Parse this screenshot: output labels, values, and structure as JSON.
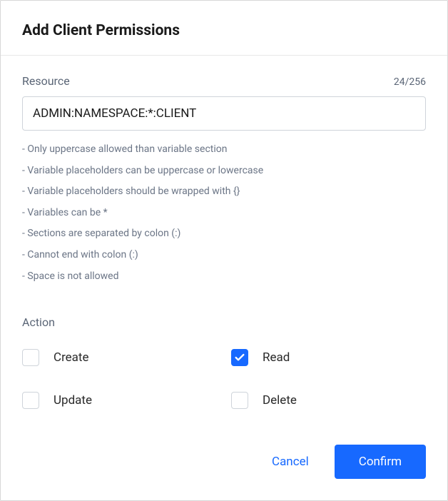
{
  "modal": {
    "title": "Add Client Permissions"
  },
  "resource": {
    "label": "Resource",
    "value": "ADMIN:NAMESPACE:*:CLIENT",
    "char_count": "24/256",
    "hints": [
      "Only uppercase allowed than variable section",
      "Variable placeholders can be uppercase or lowercase",
      "Variable placeholders should be wrapped with {}",
      "Variables can be *",
      "Sections are separated by colon (:)",
      "Cannot end with colon (:)",
      "Space is not allowed"
    ]
  },
  "action": {
    "label": "Action",
    "options": [
      {
        "label": "Create",
        "checked": false
      },
      {
        "label": "Read",
        "checked": true
      },
      {
        "label": "Update",
        "checked": false
      },
      {
        "label": "Delete",
        "checked": false
      }
    ]
  },
  "footer": {
    "cancel_label": "Cancel",
    "confirm_label": "Confirm"
  }
}
